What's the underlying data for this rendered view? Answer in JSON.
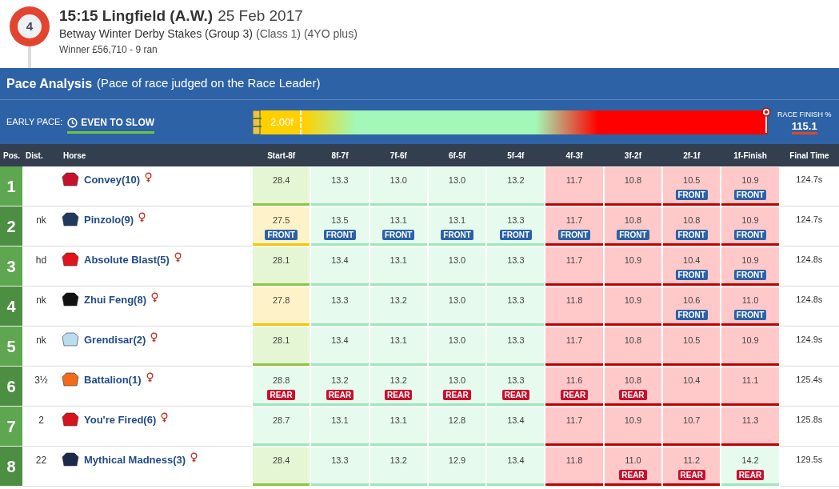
{
  "race": {
    "number": "4",
    "time_course": "15:15 Lingfield (A.W.)",
    "date": "25 Feb 2017",
    "name": "Betway Winter Derby Stakes (Group 3)",
    "details": "(Class 1) (4YO plus)",
    "summary": "Winner £56,710 - 9 ran"
  },
  "pace_analysis": {
    "title": "Pace Analysis",
    "subtitle": "(Pace of race judged on the Race Leader)",
    "early_pace_label": "EARLY PACE:",
    "early_pace_value": "EVEN TO SLOW",
    "bar_marker": "2.00f",
    "finish_label": "RACE FINISH %",
    "finish_value": "115.1"
  },
  "table": {
    "columns": [
      "Pos.",
      "Dist.",
      "Horse",
      "Start-8f",
      "8f-7f",
      "7f-6f",
      "6f-5f",
      "5f-4f",
      "4f-3f",
      "3f-2f",
      "2f-1f",
      "1f-Finish",
      "Final Time"
    ],
    "rows": [
      {
        "cells": [
          {
            "kind": "pos",
            "text": "1"
          },
          {
            "kind": "dist",
            "text": ""
          },
          {
            "kind": "horse",
            "text": "Convey(10)",
            "color": "#c8102e"
          },
          {
            "kind": "split",
            "text": "28.4",
            "color": "#e5f6d5"
          },
          {
            "kind": "split",
            "text": "13.3",
            "color": "#e6fbee"
          },
          {
            "kind": "split",
            "text": "13.0",
            "color": "#e6fbee"
          },
          {
            "kind": "split",
            "text": "13.0",
            "color": "#e6fbee"
          },
          {
            "kind": "split",
            "text": "13.2",
            "color": "#e6fbee"
          },
          {
            "kind": "split",
            "text": "11.7",
            "color": "#ffc9c9"
          },
          {
            "kind": "split",
            "text": "10.8",
            "color": "#ffc9c9"
          },
          {
            "kind": "split",
            "text": "10.5",
            "color": "#ffc9c9",
            "tag": {
              "kind": "front",
              "label": "FRONT"
            }
          },
          {
            "kind": "split",
            "text": "10.9",
            "color": "#ffc9c9",
            "tag": {
              "kind": "front",
              "label": "FRONT"
            }
          },
          {
            "kind": "final",
            "text": "124.7s"
          }
        ]
      },
      {
        "cells": [
          {
            "kind": "pos",
            "text": "2"
          },
          {
            "kind": "dist",
            "text": "nk"
          },
          {
            "kind": "horse",
            "text": "Pinzolo(9)",
            "color": "#1f3a5f"
          },
          {
            "kind": "split",
            "text": "27.5",
            "color": "#fdf2c8",
            "tag": {
              "kind": "front",
              "label": "FRONT"
            }
          },
          {
            "kind": "split",
            "text": "13.5",
            "color": "#e6fbee",
            "tag": {
              "kind": "front",
              "label": "FRONT"
            }
          },
          {
            "kind": "split",
            "text": "13.1",
            "color": "#e6fbee",
            "tag": {
              "kind": "front",
              "label": "FRONT"
            }
          },
          {
            "kind": "split",
            "text": "13.1",
            "color": "#e6fbee",
            "tag": {
              "kind": "front",
              "label": "FRONT"
            }
          },
          {
            "kind": "split",
            "text": "13.3",
            "color": "#e6fbee",
            "tag": {
              "kind": "front",
              "label": "FRONT"
            }
          },
          {
            "kind": "split",
            "text": "11.7",
            "color": "#ffc9c9",
            "tag": {
              "kind": "front",
              "label": "FRONT"
            }
          },
          {
            "kind": "split",
            "text": "10.8",
            "color": "#ffc9c9",
            "tag": {
              "kind": "front",
              "label": "FRONT"
            }
          },
          {
            "kind": "split",
            "text": "10.8",
            "color": "#ffc9c9",
            "tag": {
              "kind": "front",
              "label": "FRONT"
            }
          },
          {
            "kind": "split",
            "text": "10.9",
            "color": "#ffc9c9",
            "tag": {
              "kind": "front",
              "label": "FRONT"
            }
          },
          {
            "kind": "final",
            "text": "124.7s"
          }
        ]
      },
      {
        "cells": [
          {
            "kind": "pos",
            "text": "3"
          },
          {
            "kind": "dist",
            "text": "hd"
          },
          {
            "kind": "horse",
            "text": "Absolute Blast(5)",
            "color": "#e3121b"
          },
          {
            "kind": "split",
            "text": "28.1",
            "color": "#e5f6d5"
          },
          {
            "kind": "split",
            "text": "13.4",
            "color": "#e6fbee"
          },
          {
            "kind": "split",
            "text": "13.1",
            "color": "#e6fbee"
          },
          {
            "kind": "split",
            "text": "13.0",
            "color": "#e6fbee"
          },
          {
            "kind": "split",
            "text": "13.3",
            "color": "#e6fbee"
          },
          {
            "kind": "split",
            "text": "11.7",
            "color": "#ffc9c9"
          },
          {
            "kind": "split",
            "text": "10.9",
            "color": "#ffc9c9"
          },
          {
            "kind": "split",
            "text": "10.4",
            "color": "#ffc9c9",
            "tag": {
              "kind": "front",
              "label": "FRONT"
            }
          },
          {
            "kind": "split",
            "text": "10.9",
            "color": "#ffc9c9",
            "tag": {
              "kind": "front",
              "label": "FRONT"
            }
          },
          {
            "kind": "final",
            "text": "124.8s"
          }
        ]
      },
      {
        "cells": [
          {
            "kind": "pos",
            "text": "4"
          },
          {
            "kind": "dist",
            "text": "nk"
          },
          {
            "kind": "horse",
            "text": "Zhui Feng(8)",
            "color": "#111111"
          },
          {
            "kind": "split",
            "text": "27.8",
            "color": "#fdf2c8"
          },
          {
            "kind": "split",
            "text": "13.3",
            "color": "#e6fbee"
          },
          {
            "kind": "split",
            "text": "13.2",
            "color": "#e6fbee"
          },
          {
            "kind": "split",
            "text": "13.0",
            "color": "#e6fbee"
          },
          {
            "kind": "split",
            "text": "13.3",
            "color": "#e6fbee"
          },
          {
            "kind": "split",
            "text": "11.8",
            "color": "#ffc9c9"
          },
          {
            "kind": "split",
            "text": "10.9",
            "color": "#ffc9c9"
          },
          {
            "kind": "split",
            "text": "10.6",
            "color": "#ffc9c9",
            "tag": {
              "kind": "front",
              "label": "FRONT"
            }
          },
          {
            "kind": "split",
            "text": "11.0",
            "color": "#ffc9c9",
            "tag": {
              "kind": "front",
              "label": "FRONT"
            }
          },
          {
            "kind": "final",
            "text": "124.8s"
          }
        ]
      },
      {
        "cells": [
          {
            "kind": "pos",
            "text": "5"
          },
          {
            "kind": "dist",
            "text": "nk"
          },
          {
            "kind": "horse",
            "text": "Grendisar(2)",
            "color": "#b9dcef"
          },
          {
            "kind": "split",
            "text": "28.1",
            "color": "#e5f6d5"
          },
          {
            "kind": "split",
            "text": "13.4",
            "color": "#e6fbee"
          },
          {
            "kind": "split",
            "text": "13.1",
            "color": "#e6fbee"
          },
          {
            "kind": "split",
            "text": "13.0",
            "color": "#e6fbee"
          },
          {
            "kind": "split",
            "text": "13.3",
            "color": "#e6fbee"
          },
          {
            "kind": "split",
            "text": "11.7",
            "color": "#ffc9c9"
          },
          {
            "kind": "split",
            "text": "10.8",
            "color": "#ffc9c9"
          },
          {
            "kind": "split",
            "text": "10.5",
            "color": "#ffc9c9"
          },
          {
            "kind": "split",
            "text": "10.9",
            "color": "#ffc9c9"
          },
          {
            "kind": "final",
            "text": "124.9s"
          }
        ]
      },
      {
        "cells": [
          {
            "kind": "pos",
            "text": "6"
          },
          {
            "kind": "dist",
            "text": "3½"
          },
          {
            "kind": "horse",
            "text": "Battalion(1)",
            "color": "#f26a1b"
          },
          {
            "kind": "split",
            "text": "28.8",
            "color": "#e6fbee",
            "tag": {
              "kind": "rear",
              "label": "REAR"
            }
          },
          {
            "kind": "split",
            "text": "13.2",
            "color": "#e6fbee",
            "tag": {
              "kind": "rear",
              "label": "REAR"
            }
          },
          {
            "kind": "split",
            "text": "13.2",
            "color": "#e6fbee",
            "tag": {
              "kind": "rear",
              "label": "REAR"
            }
          },
          {
            "kind": "split",
            "text": "13.0",
            "color": "#e6fbee",
            "tag": {
              "kind": "rear",
              "label": "REAR"
            }
          },
          {
            "kind": "split",
            "text": "13.3",
            "color": "#e6fbee",
            "tag": {
              "kind": "rear",
              "label": "REAR"
            }
          },
          {
            "kind": "split",
            "text": "11.6",
            "color": "#ffc9c9",
            "tag": {
              "kind": "rear",
              "label": "REAR"
            }
          },
          {
            "kind": "split",
            "text": "10.8",
            "color": "#ffc9c9",
            "tag": {
              "kind": "rear",
              "label": "REAR"
            }
          },
          {
            "kind": "split",
            "text": "10.4",
            "color": "#ffc9c9"
          },
          {
            "kind": "split",
            "text": "11.1",
            "color": "#ffc9c9"
          },
          {
            "kind": "final",
            "text": "125.4s"
          }
        ]
      },
      {
        "cells": [
          {
            "kind": "pos",
            "text": "7"
          },
          {
            "kind": "dist",
            "text": "2"
          },
          {
            "kind": "horse",
            "text": "You're Fired(6)",
            "color": "#d7141e"
          },
          {
            "kind": "split",
            "text": "28.7",
            "color": "#e6fbee"
          },
          {
            "kind": "split",
            "text": "13.1",
            "color": "#e6fbee"
          },
          {
            "kind": "split",
            "text": "13.1",
            "color": "#e6fbee"
          },
          {
            "kind": "split",
            "text": "12.8",
            "color": "#e6fbee"
          },
          {
            "kind": "split",
            "text": "13.4",
            "color": "#e6fbee"
          },
          {
            "kind": "split",
            "text": "11.7",
            "color": "#ffc9c9"
          },
          {
            "kind": "split",
            "text": "10.9",
            "color": "#ffc9c9"
          },
          {
            "kind": "split",
            "text": "10.7",
            "color": "#ffc9c9"
          },
          {
            "kind": "split",
            "text": "11.3",
            "color": "#ffc9c9"
          },
          {
            "kind": "final",
            "text": "125.8s"
          }
        ]
      },
      {
        "cells": [
          {
            "kind": "pos",
            "text": "8"
          },
          {
            "kind": "dist",
            "text": "22"
          },
          {
            "kind": "horse",
            "text": "Mythical Madness(3)",
            "color": "#1b2a4a"
          },
          {
            "kind": "split",
            "text": "28.4",
            "color": "#e5f6d5"
          },
          {
            "kind": "split",
            "text": "13.3",
            "color": "#e6fbee"
          },
          {
            "kind": "split",
            "text": "13.2",
            "color": "#e6fbee"
          },
          {
            "kind": "split",
            "text": "12.9",
            "color": "#e6fbee"
          },
          {
            "kind": "split",
            "text": "13.4",
            "color": "#e6fbee"
          },
          {
            "kind": "split",
            "text": "11.8",
            "color": "#ffc9c9"
          },
          {
            "kind": "split",
            "text": "11.0",
            "color": "#ffc9c9",
            "tag": {
              "kind": "rear",
              "label": "REAR"
            }
          },
          {
            "kind": "split",
            "text": "11.2",
            "color": "#ffc9c9",
            "tag": {
              "kind": "rear",
              "label": "REAR"
            }
          },
          {
            "kind": "split",
            "text": "14.2",
            "color": "#e6fbee",
            "tag": {
              "kind": "rear",
              "label": "REAR"
            }
          },
          {
            "kind": "final",
            "text": "129.5s"
          }
        ]
      }
    ]
  }
}
